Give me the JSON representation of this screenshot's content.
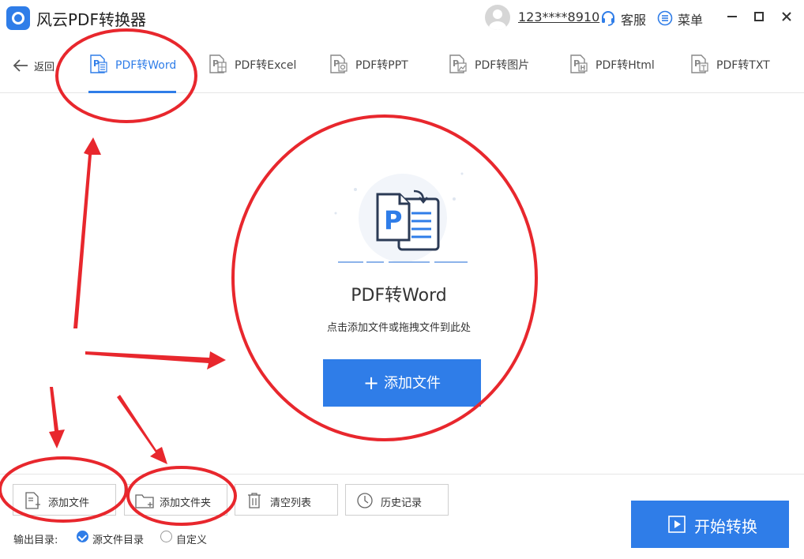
{
  "app": {
    "title": "风云PDF转换器"
  },
  "header": {
    "account": "123****8910",
    "service_label": "客服",
    "menu_label": "菜单"
  },
  "tabbar": {
    "back_label": "返回",
    "tabs": [
      {
        "label": "PDF转Word",
        "active": true
      },
      {
        "label": "PDF转Excel",
        "active": false
      },
      {
        "label": "PDF转PPT",
        "active": false
      },
      {
        "label": "PDF转图片",
        "active": false
      },
      {
        "label": "PDF转Html",
        "active": false
      },
      {
        "label": "PDF转TXT",
        "active": false
      }
    ]
  },
  "dropzone": {
    "title": "PDF转Word",
    "hint": "点击添加文件或拖拽文件到此处",
    "add_button": "添加文件"
  },
  "toolbar": {
    "add_file": "添加文件",
    "add_folder": "添加文件夹",
    "clear_list": "清空列表",
    "history": "历史记录"
  },
  "output": {
    "label": "输出目录:",
    "options": [
      {
        "label": "源文件目录",
        "selected": true
      },
      {
        "label": "自定义",
        "selected": false
      }
    ]
  },
  "start_button": "开始转换",
  "colors": {
    "accent": "#2f7de8",
    "annotation": "#e8272d"
  }
}
